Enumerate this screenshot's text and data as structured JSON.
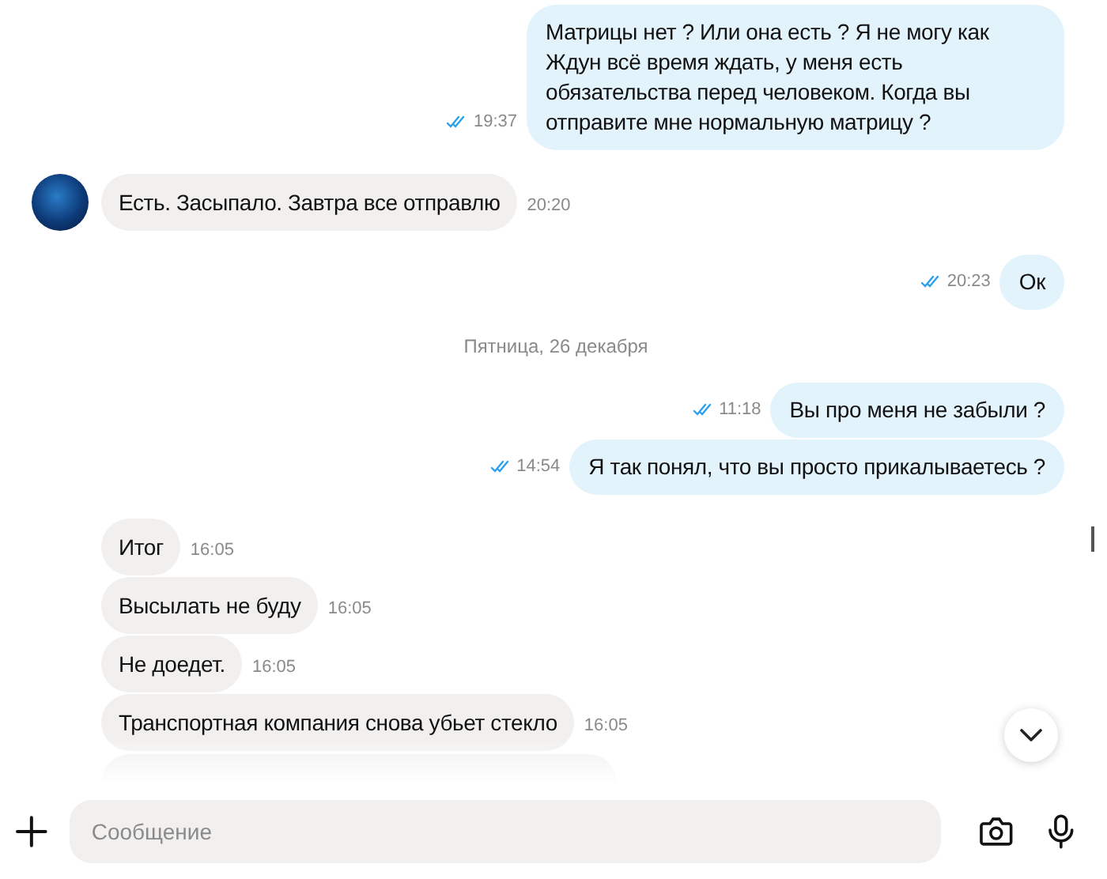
{
  "messages": [
    {
      "kind": "outgoing",
      "text": "Матрицы нет ? Или она есть ? Я не могу как Ждун всё время ждать, у меня есть обязательства перед человеком.  Когда вы отправите мне нормальную матрицу ?",
      "time": "19:37",
      "read": true
    },
    {
      "kind": "incoming",
      "text": "Есть.  Засыпало. Завтра все отправлю",
      "time": "20:20",
      "avatar": true
    },
    {
      "kind": "outgoing",
      "text": "Ок",
      "time": "20:23",
      "read": true
    },
    {
      "kind": "date",
      "text": "Пятница, 26 декабря"
    },
    {
      "kind": "outgoing",
      "text": "Вы про меня не забыли ?",
      "time": "11:18",
      "read": true
    },
    {
      "kind": "outgoing",
      "text": "Я так понял, что вы просто прикалываетесь ?",
      "time": "14:54",
      "read": true
    },
    {
      "kind": "incoming",
      "text": "Итог",
      "time": "16:05",
      "avatar": false
    },
    {
      "kind": "incoming",
      "text": "Высылать не буду",
      "time": "16:05",
      "avatar": false
    },
    {
      "kind": "incoming",
      "text": "Не доедет.",
      "time": "16:05",
      "avatar": false
    },
    {
      "kind": "incoming",
      "text": "Транспортная компания снова убьет стекло",
      "time": "16:05",
      "avatar": false
    },
    {
      "kind": "cut_off"
    }
  ],
  "composer": {
    "placeholder": "Сообщение"
  }
}
